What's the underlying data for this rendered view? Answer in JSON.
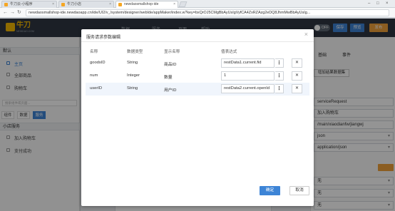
{
  "browser": {
    "tabs": [
      {
        "label": "牛刀云-小程序",
        "icon_color": "#f5a623"
      },
      {
        "label": "牛刀小店",
        "icon_color": "#f5a623"
      },
      {
        "label": "newdaosmallshop-ide",
        "icon_color": "#f5a623"
      }
    ],
    "url": "newdaosmallshop-ide.newdaoapp.cn/ide/UI2/v_/system/designer/webIde/appMaker/index.w?key=bxQrOJ5CMgBbAyUsIgVyfCA4ZxRZAzg2eDQ8JhmMwBbAyUsIg..."
  },
  "header": {
    "logo_text": "牛刀",
    "logo_sub": "NEWDAO.COM",
    "nav": [
      "数据",
      "服务",
      "页面",
      "帮助"
    ],
    "toggle_label": "OFF",
    "save_label": "保存",
    "preview_label": "预览",
    "publish_label": "发布",
    "accent": "#3d84d6",
    "warn": "#f0a03a"
  },
  "left_panel": {
    "top_item": "默认",
    "items": [
      "主页",
      "全部商品",
      "购物车"
    ],
    "search_placeholder": "搜索组件或页面...",
    "tabs": [
      "组件",
      "数据",
      "服务"
    ],
    "section": "小店服务",
    "services": [
      "加入购物车",
      "支付成功"
    ]
  },
  "right_panel": {
    "tabs": [
      "基础",
      "事件"
    ],
    "buttons": [
      "增加结果数据集"
    ],
    "fields": [
      "serviceRequest",
      "加入购物车",
      "/main/xiaodianfw/jiangwj",
      "json",
      "application/json",
      "无",
      "无",
      "无"
    ]
  },
  "modal": {
    "title": "服务请求参数编辑",
    "close": "×",
    "headers": [
      "名称",
      "数据类型",
      "显示名称",
      "值表达式"
    ],
    "rows": [
      {
        "name": "goodsID",
        "type": "String",
        "display": "商品ID",
        "expr": "restData1.current.fid"
      },
      {
        "name": "num",
        "type": "Integer",
        "display": "数量",
        "expr": "1"
      },
      {
        "name": "userID",
        "type": "String",
        "display": "用户ID",
        "expr": "restData2.current.openId"
      }
    ],
    "more_glyph": "⋮",
    "delete_glyph": "✕",
    "ok_label": "确定",
    "cancel_label": "取消"
  }
}
